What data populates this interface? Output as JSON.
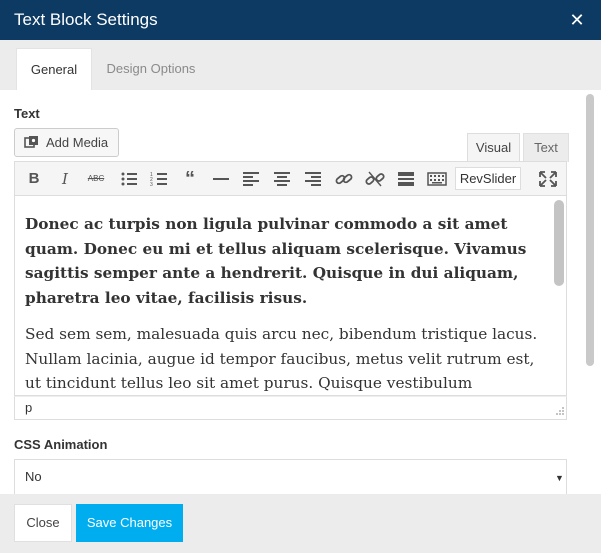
{
  "window": {
    "title": "Text Block Settings"
  },
  "tabs": [
    {
      "label": "General"
    },
    {
      "label": "Design Options"
    }
  ],
  "text_section": {
    "label": "Text",
    "add_media_label": "Add Media",
    "editor_tabs": {
      "visual": "Visual",
      "text": "Text"
    },
    "toolbar_icons": [
      "bold-icon",
      "italic-icon",
      "strikethrough-icon",
      "bullet-list-icon",
      "numbered-list-icon",
      "blockquote-icon",
      "horizontal-rule-icon",
      "align-left-icon",
      "align-center-icon",
      "align-right-icon",
      "link-icon",
      "unlink-icon",
      "read-more-icon",
      "toolbar-toggle-icon",
      "fullscreen-icon"
    ],
    "revslider_label": "RevSlider",
    "paragraphs": [
      "Donec ac turpis non ligula pulvinar commodo a sit amet quam. Donec eu mi et tellus aliquam scelerisque. Vivamus sagittis semper ante a hendrerit. Quisque in dui aliquam, pharetra leo vitae, facilisis risus.",
      "Sed sem sem, malesuada quis arcu nec, bibendum tristique lacus. Nullam lacinia, augue id tempor faucibus, metus velit rutrum est, ut tincidunt tellus leo sit amet purus. Quisque vestibulum condimentum"
    ],
    "status_path": "p"
  },
  "css_animation": {
    "label": "CSS Animation",
    "selected": "No"
  },
  "footer": {
    "close_label": "Close",
    "save_label": "Save Changes"
  },
  "colors": {
    "titlebar": "#0d3a63",
    "save_button": "#00aef0"
  }
}
